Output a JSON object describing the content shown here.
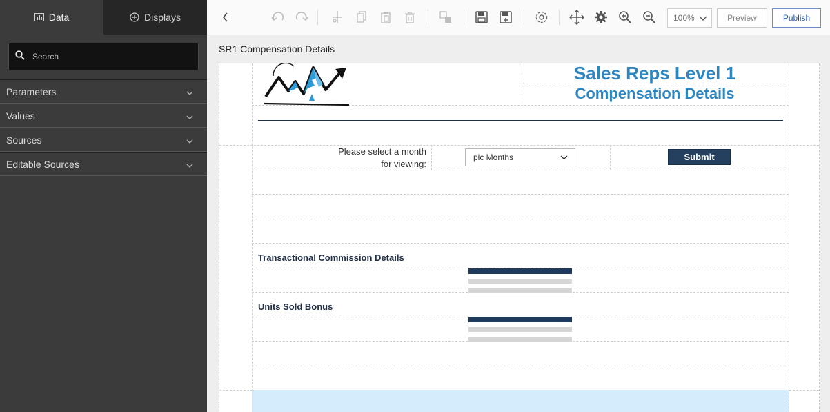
{
  "sidebar": {
    "tabs": [
      {
        "label": "Data",
        "icon": "bar-chart-icon",
        "active": true
      },
      {
        "label": "Displays",
        "icon": "plus-circle-icon",
        "active": false
      }
    ],
    "search": {
      "placeholder": "Search",
      "value": ""
    },
    "sections": [
      {
        "label": "Parameters"
      },
      {
        "label": "Values"
      },
      {
        "label": "Sources"
      },
      {
        "label": "Editable Sources"
      }
    ]
  },
  "toolbar": {
    "icons": [
      "chevron-left-icon",
      "undo-icon",
      "redo-icon",
      "cut-icon",
      "copy-icon",
      "paste-icon",
      "delete-icon",
      "group-icon",
      "save-icon",
      "save-as-icon",
      "settings-icon",
      "move-icon",
      "gear-icon",
      "zoom-in-icon",
      "zoom-out-icon"
    ],
    "zoom": "100%",
    "preview_label": "Preview",
    "publish_label": "Publish"
  },
  "page": {
    "title": "SR1 Compensation Details"
  },
  "report": {
    "title_line1": "Sales Reps Level 1",
    "title_line2": "Compensation Details",
    "prompt": "Please select a month for viewing:",
    "month_select": "plc Months",
    "submit_label": "Submit",
    "section1": "Transactional Commission Details",
    "section2": "Units Sold Bonus"
  },
  "colors": {
    "accent_blue": "#2e86c1",
    "navy": "#1f2d45",
    "submit_bg": "#24405e",
    "sidebar_bg": "#3b3b3b",
    "selected_band": "#d4ecfb"
  }
}
